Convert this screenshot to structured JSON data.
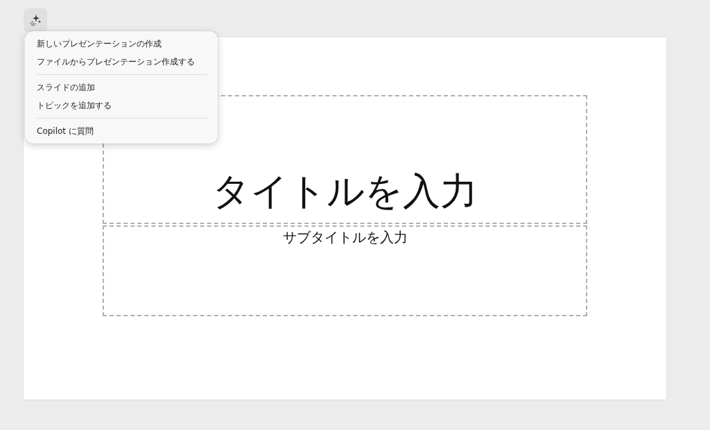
{
  "copilot_button": {
    "kind": "sparkle"
  },
  "menu": {
    "groups": [
      {
        "items": [
          "新しいプレゼンテーションの作成",
          "ファイルからプレゼンテーション作成する"
        ]
      },
      {
        "items": [
          "スライドの追加",
          "トピックを追加する"
        ]
      },
      {
        "items": [
          "Copilot に質問"
        ]
      }
    ]
  },
  "slide": {
    "title_placeholder": "タイトルを入力",
    "subtitle_placeholder": "サブタイトルを入力"
  }
}
